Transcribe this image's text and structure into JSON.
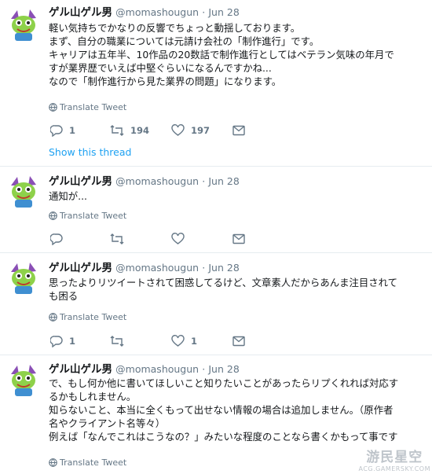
{
  "tweets": [
    {
      "name": "ゲル山ゲル男",
      "handle": "@momashougun",
      "separator": "·",
      "date": "Jun 28",
      "lines": [
        "軽い気持ちでかなりの反響でちょっと動揺しております。",
        "まず、自分の職業については元請け会社の「制作進行」です。",
        "キャリアは五年半、10作品の20数話で制作進行としてはベテラン気味の年月で",
        "すが業界歴でいえば中堅ぐらいになるんですかね...",
        "なので「制作進行から見た業界の問題」になります。"
      ],
      "translate": "Translate Tweet",
      "replies": "1",
      "retweets": "194",
      "likes": "197",
      "show_thread": "Show this thread"
    },
    {
      "name": "ゲル山ゲル男",
      "handle": "@momashougun",
      "separator": "·",
      "date": "Jun 28",
      "lines": [
        "通知が..."
      ],
      "translate": "Translate Tweet",
      "replies": "",
      "retweets": "",
      "likes": ""
    },
    {
      "name": "ゲル山ゲル男",
      "handle": "@momashougun",
      "separator": "·",
      "date": "Jun 28",
      "lines": [
        "思ったよりリツイートされて困惑してるけど、文章素人だからあんま注目されて",
        "も困る"
      ],
      "translate": "Translate Tweet",
      "replies": "1",
      "retweets": "",
      "likes": "1"
    },
    {
      "name": "ゲル山ゲル男",
      "handle": "@momashougun",
      "separator": "·",
      "date": "Jun 28",
      "lines": [
        "で、もし何か他に書いてほしいこと知りたいことがあったらリプくれれば対応す",
        "るかもしれません。",
        "知らないこと、本当に全くもって出せない情報の場合は追加しません。（原作者",
        "名やクライアント名等々）",
        "例えば「なんでこれはこうなの？」みたいな程度のことなら書くかもって事です"
      ],
      "translate": "Translate Tweet"
    }
  ],
  "watermark": {
    "line1": "游民星空",
    "line2": "ACG.GAMERSKY.COM"
  },
  "colors": {
    "accent": "#1da1f2",
    "muted": "#657786",
    "text": "#14171a",
    "divider": "#e6ecf0"
  },
  "icons": [
    "reply-icon",
    "retweet-icon",
    "like-icon",
    "message-icon",
    "globe-icon"
  ]
}
